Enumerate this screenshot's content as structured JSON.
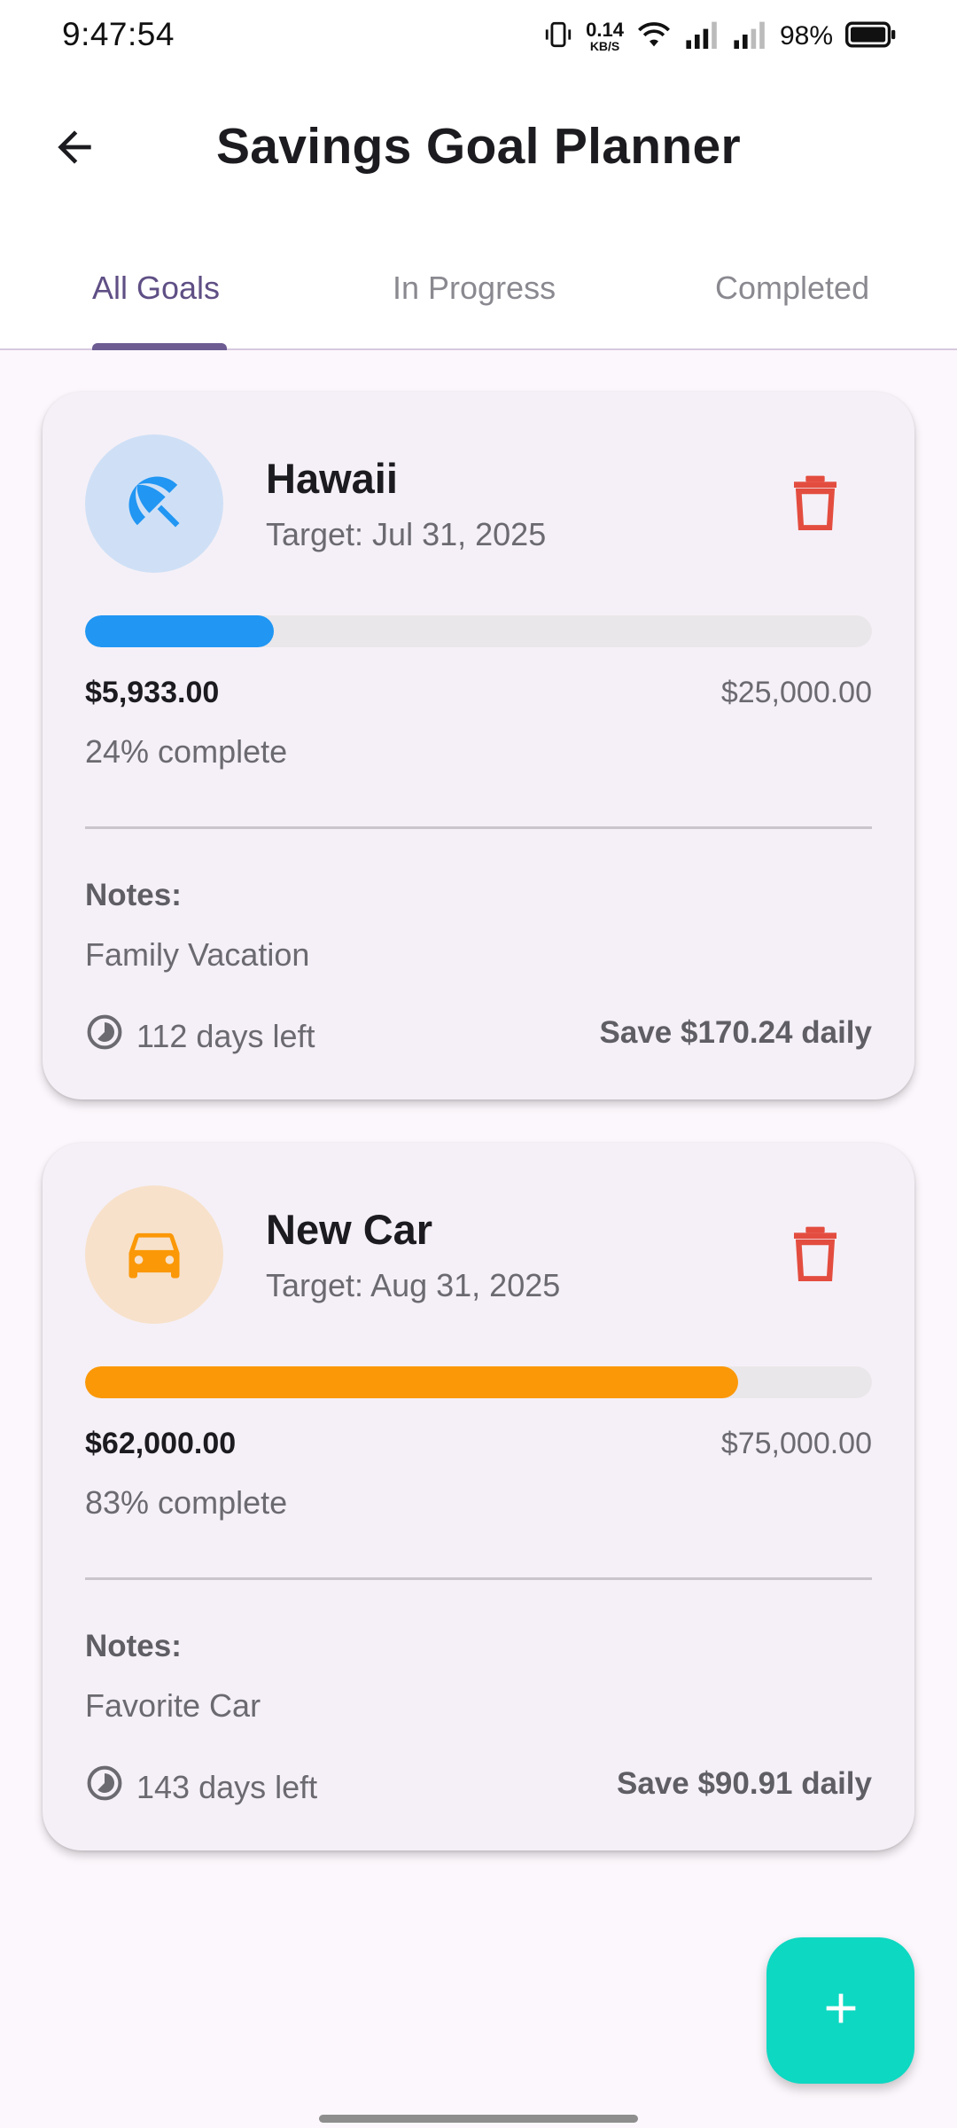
{
  "status_bar": {
    "time": "9:47:54",
    "net_speed_value": "0.14",
    "net_speed_unit": "KB/S",
    "battery_percent": "98%"
  },
  "app_bar": {
    "title": "Savings Goal Planner",
    "back_icon": "arrow-back-icon"
  },
  "tabs": [
    {
      "label": "All Goals",
      "active": true
    },
    {
      "label": "In Progress",
      "active": false
    },
    {
      "label": "Completed",
      "active": false
    }
  ],
  "goals": [
    {
      "name": "Hawaii",
      "target_date": "Target: Jul 31, 2025",
      "icon": "beach-umbrella-icon",
      "accent_color": "#2196f3",
      "avatar_bg": "#cfe0f6",
      "saved": "$5,933.00",
      "target": "$25,000.00",
      "progress_percent": 24,
      "percent_label": "24% complete",
      "notes_label": "Notes:",
      "notes": "Family Vacation",
      "days_left": "112 days left",
      "daily_save": "Save $170.24 daily"
    },
    {
      "name": "New Car",
      "target_date": "Target: Aug 31, 2025",
      "icon": "car-icon",
      "accent_color": "#fb9807",
      "avatar_bg": "#f7e1ca",
      "saved": "$62,000.00",
      "target": "$75,000.00",
      "progress_percent": 83,
      "percent_label": "83% complete",
      "notes_label": "Notes:",
      "notes": "Favorite Car",
      "days_left": "143 days left",
      "daily_save": "Save $90.91 daily"
    }
  ],
  "fab": {
    "icon": "add-icon",
    "color": "#0dd8c2"
  },
  "colors": {
    "primary": "#6c5c92",
    "delete": "#e34d3f",
    "background": "#fcf7fc"
  }
}
